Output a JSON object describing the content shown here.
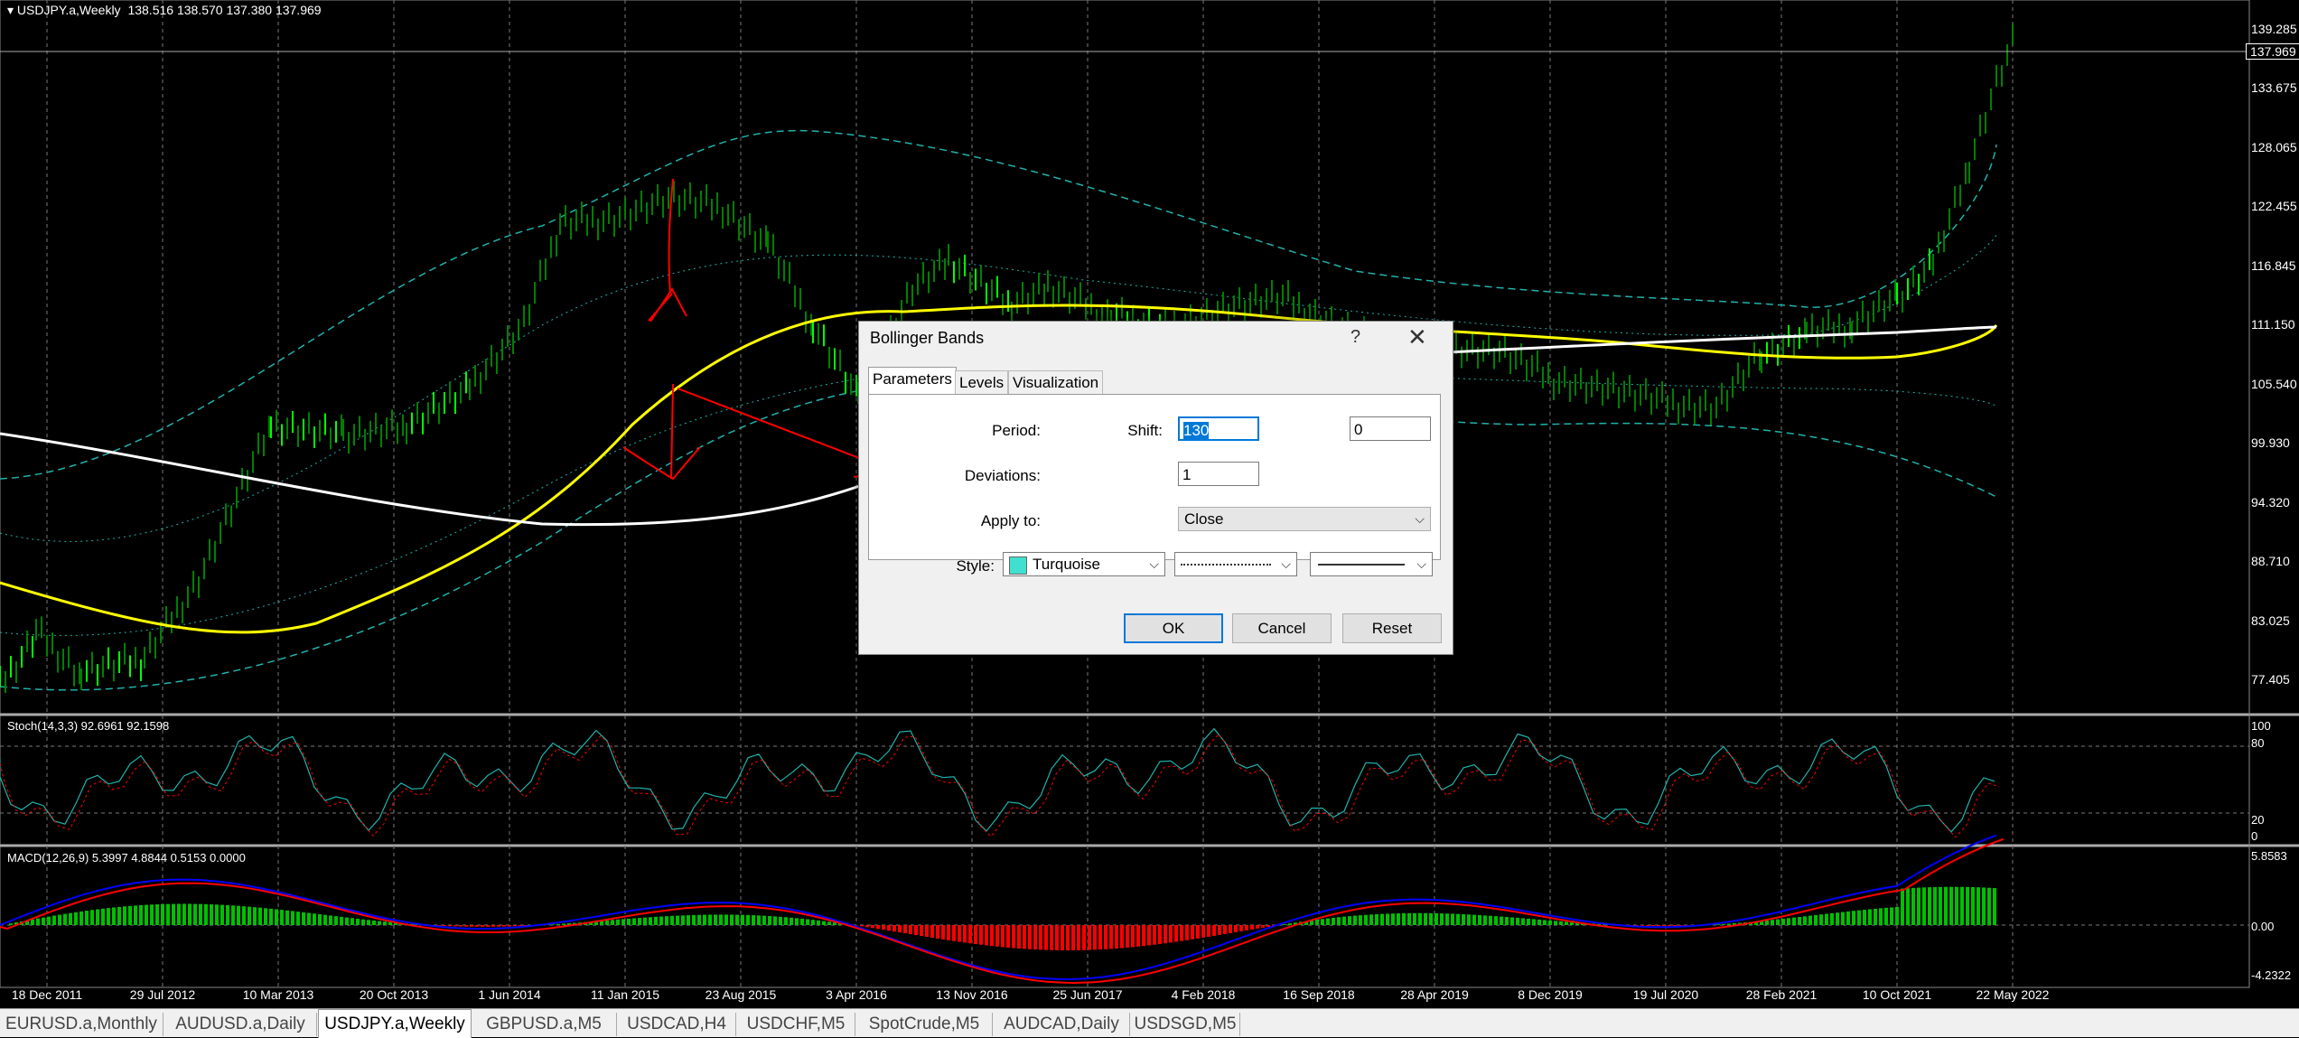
{
  "window": {
    "title": "USDJPY.a,Weekly",
    "ohlc": "138.516 138.570 137.380 137.969"
  },
  "price_axis": {
    "labels": [
      "139.285",
      "133.675",
      "128.065",
      "122.455",
      "116.845",
      "111.150",
      "105.540",
      "99.930",
      "94.320",
      "88.710",
      "83.025",
      "77.405"
    ],
    "current_price": "137.969"
  },
  "stoch": {
    "label": "Stoch(14,3,3) 92.6961 92.1598",
    "levels": [
      "100",
      "80",
      "20",
      "0"
    ]
  },
  "macd": {
    "label": "MACD(12,26,9) 5.3997 4.8844 0.5153 0.0000",
    "levels": [
      "5.8583",
      "0.00",
      "-4.2322"
    ]
  },
  "time_axis": [
    "18 Dec 2011",
    "29 Jul 2012",
    "10 Mar 2013",
    "20 Oct 2013",
    "1 Jun 2014",
    "11 Jan 2015",
    "23 Aug 2015",
    "3 Apr 2016",
    "13 Nov 2016",
    "25 Jun 2017",
    "4 Feb 2018",
    "16 Sep 2018",
    "28 Apr 2019",
    "8 Dec 2019",
    "19 Jul 2020",
    "28 Feb 2021",
    "10 Oct 2021",
    "22 May 2022"
  ],
  "tabs": [
    {
      "label": "EURUSD.a,Monthly",
      "active": false
    },
    {
      "label": "AUDUSD.a,Daily",
      "active": false
    },
    {
      "label": "USDJPY.a,Weekly",
      "active": true
    },
    {
      "label": "GBPUSD.a,M5",
      "active": false
    },
    {
      "label": "USDCAD,H4",
      "active": false
    },
    {
      "label": "USDCHF,M5",
      "active": false
    },
    {
      "label": "SpotCrude,M5",
      "active": false
    },
    {
      "label": "AUDCAD,Daily",
      "active": false
    },
    {
      "label": "USDSGD,M5",
      "active": false
    }
  ],
  "dialog": {
    "title": "Bollinger Bands",
    "help": "?",
    "close": "✕",
    "tabs": [
      "Parameters",
      "Levels",
      "Visualization"
    ],
    "period_label": "Period:",
    "period_value": "130",
    "shift_label": "Shift:",
    "shift_value": "0",
    "deviations_label": "Deviations:",
    "deviations_value": "1",
    "apply_label": "Apply to:",
    "apply_value": "Close",
    "style_label": "Style:",
    "style_color": "Turquoise",
    "ok": "OK",
    "cancel": "Cancel",
    "reset": "Reset"
  },
  "colors": {
    "ma_fast": "#ffff00",
    "ma_slow": "#ffffff",
    "bands": "#20b2aa",
    "candle": "#00ff00",
    "macd_line": "#0000ff",
    "signal_line": "#ff0000",
    "annotation": "#ff0000"
  }
}
